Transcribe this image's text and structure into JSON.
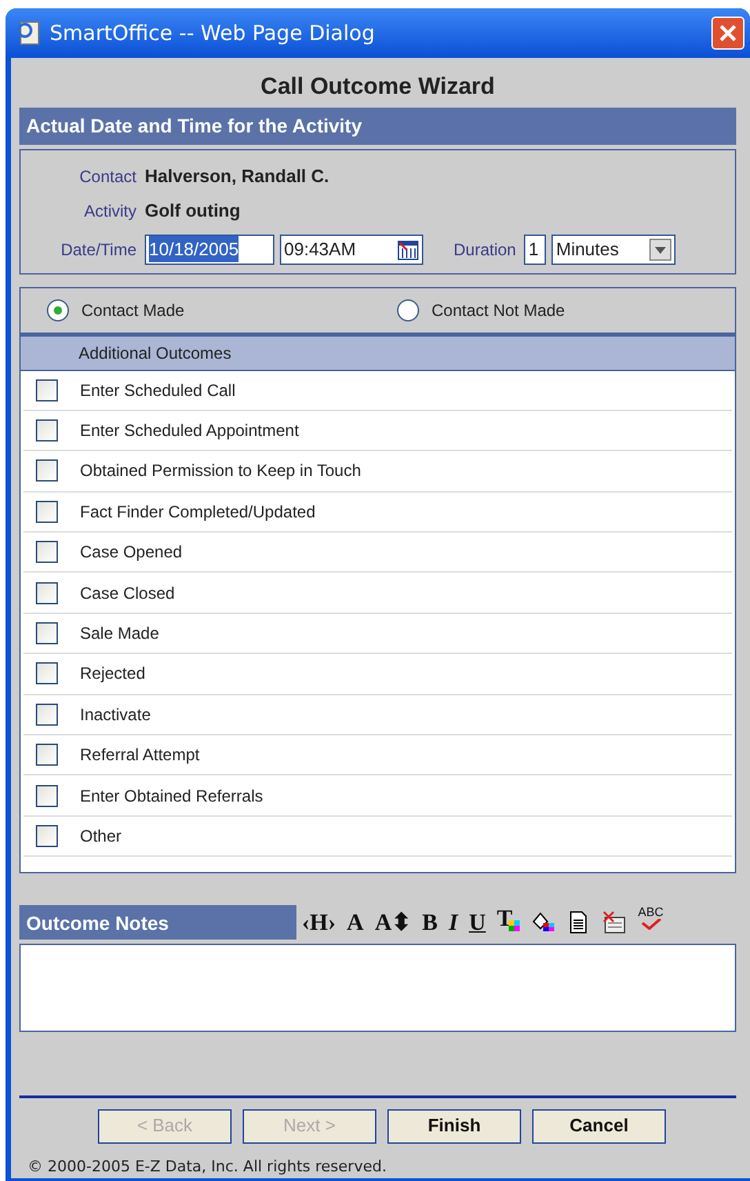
{
  "window": {
    "title": "SmartOffice -- Web Page Dialog"
  },
  "heading": "Call Outcome Wizard",
  "section": {
    "title": "Actual Date and Time for the Activity"
  },
  "details": [
    {
      "label": "Contact",
      "value": "Halverson, Randall C."
    },
    {
      "label": "Activity",
      "value": "Golf outing"
    }
  ],
  "datetime": {
    "label": "Date/Time",
    "date": "10/18/2005",
    "date_highlighted": true,
    "time": "09:43AM",
    "duration_label": "Duration",
    "duration": "1",
    "unit": "Minutes"
  },
  "contact_options": [
    {
      "label": "Contact Made",
      "selected": true
    },
    {
      "label": "Contact Not Made",
      "selected": false
    }
  ],
  "outcomes": {
    "title": "Additional Outcomes",
    "items": [
      {
        "label": "Enter Scheduled Call",
        "checked": false
      },
      {
        "label": "Enter Scheduled Appointment",
        "checked": false
      },
      {
        "label": "Obtained Permission to Keep in Touch",
        "checked": false
      },
      {
        "label": "Fact Finder Completed/Updated",
        "checked": false
      },
      {
        "label": "Case Opened",
        "checked": false
      },
      {
        "label": "Case Closed",
        "checked": false
      },
      {
        "label": "Sale Made",
        "checked": false
      },
      {
        "label": "Rejected",
        "checked": false
      },
      {
        "label": "Inactivate",
        "checked": false
      },
      {
        "label": "Referral Attempt",
        "checked": false
      },
      {
        "label": "Enter Obtained Referrals",
        "checked": false
      },
      {
        "label": "Other",
        "checked": false
      }
    ]
  },
  "notes": {
    "title": "Outcome Notes",
    "tools": [
      {
        "kind": "glyph",
        "label": "‹H›"
      },
      {
        "kind": "glyph",
        "label": "A"
      },
      {
        "kind": "glyph",
        "label": "A⬍"
      },
      {
        "kind": "glyph",
        "label": "B"
      },
      {
        "kind": "italic",
        "label": "I"
      },
      {
        "kind": "underline",
        "label": "U"
      },
      {
        "kind": "text-color",
        "label": "T"
      },
      {
        "kind": "fill-color"
      },
      {
        "kind": "document"
      },
      {
        "kind": "clear"
      },
      {
        "kind": "spellcheck",
        "label": "ABC"
      }
    ]
  },
  "buttons": [
    {
      "label": "< Back",
      "disabled": true
    },
    {
      "label": "Next >",
      "disabled": true
    },
    {
      "label": "Finish",
      "disabled": false
    },
    {
      "label": "Cancel",
      "disabled": false
    }
  ],
  "footer": "© 2000-2005 E-Z Data, Inc. All rights reserved."
}
